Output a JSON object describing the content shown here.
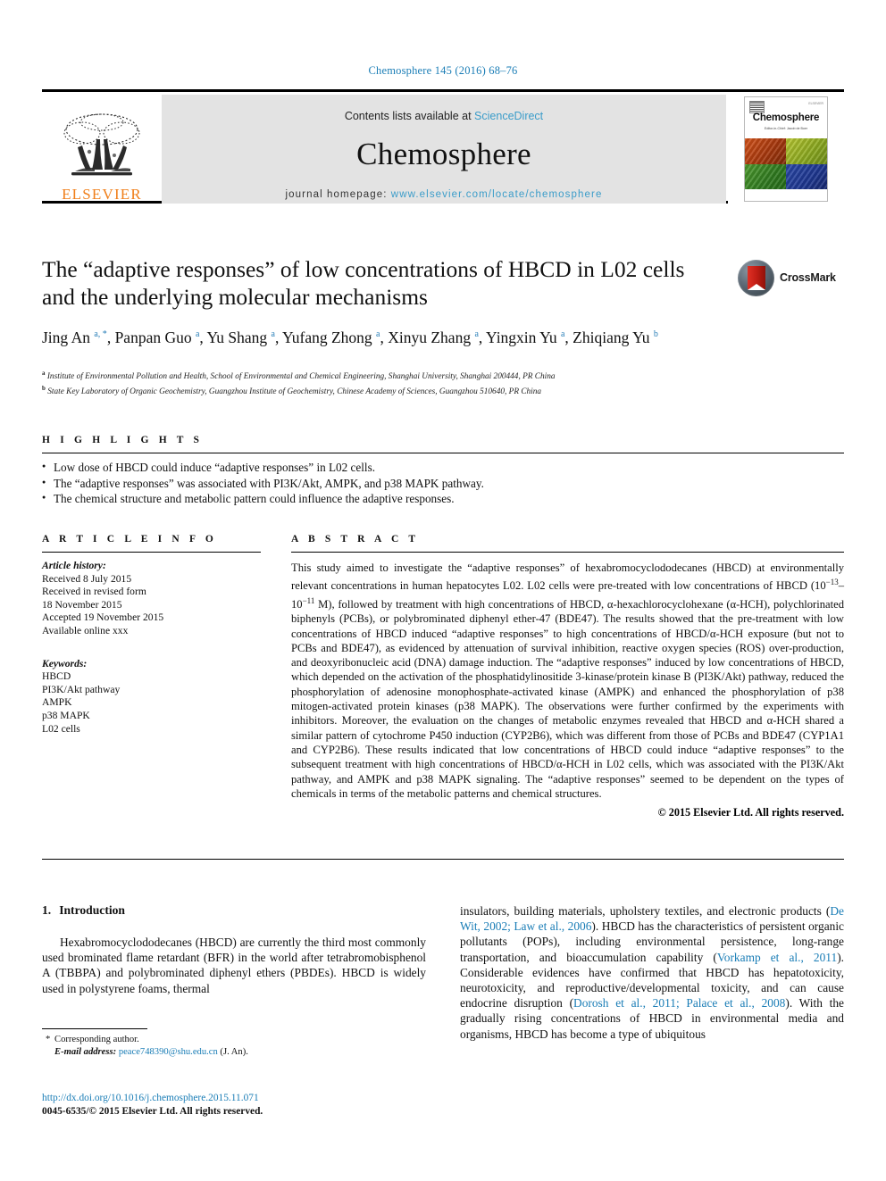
{
  "running_head": "Chemosphere 145 (2016) 68–76",
  "masthead": {
    "publisher_logo_label": "ELSEVIER",
    "contents_prefix": "Contents lists available at",
    "contents_link": "ScienceDirect",
    "journal_name": "Chemosphere",
    "homepage_prefix": "journal homepage:",
    "homepage_url": "www.elsevier.com/locate/chemosphere",
    "cover": {
      "title": "Chemosphere",
      "subtitle": "Editor-in-Chief: Jacob de Boer",
      "corner_label": "ELSEVIER"
    }
  },
  "article": {
    "title": "The “adaptive responses” of low concentrations of HBCD in L02 cells and the underlying molecular mechanisms",
    "crossmark_label": "CrossMark",
    "authors": [
      {
        "name": "Jing An",
        "sup": "a, *"
      },
      {
        "name": "Panpan Guo",
        "sup": "a"
      },
      {
        "name": "Yu Shang",
        "sup": "a"
      },
      {
        "name": "Yufang Zhong",
        "sup": "a"
      },
      {
        "name": "Xinyu Zhang",
        "sup": "a"
      },
      {
        "name": "Yingxin Yu",
        "sup": "a"
      },
      {
        "name": "Zhiqiang Yu",
        "sup": "b"
      }
    ],
    "affiliations": [
      {
        "marker": "a",
        "text": "Institute of Environmental Pollution and Health, School of Environmental and Chemical Engineering, Shanghai University, Shanghai 200444, PR China"
      },
      {
        "marker": "b",
        "text": "State Key Laboratory of Organic Geochemistry, Guangzhou Institute of Geochemistry, Chinese Academy of Sciences, Guangzhou 510640, PR China"
      }
    ]
  },
  "highlights": {
    "heading": "H I G H L I G H T S",
    "items": [
      "Low dose of HBCD could induce “adaptive responses” in L02 cells.",
      "The “adaptive responses” was associated with PI3K/Akt, AMPK, and p38 MAPK pathway.",
      "The chemical structure and metabolic pattern could influence the adaptive responses."
    ]
  },
  "article_info": {
    "heading": "A R T I C L E  I N F O",
    "history_label": "Article history:",
    "history": [
      "Received 8 July 2015",
      "Received in revised form",
      "18 November 2015",
      "Accepted 19 November 2015",
      "Available online xxx"
    ],
    "keywords_label": "Keywords:",
    "keywords": [
      "HBCD",
      "PI3K/Akt pathway",
      "AMPK",
      "p38 MAPK",
      "L02 cells"
    ]
  },
  "abstract": {
    "heading": "A B S T R A C T",
    "part1": "This study aimed to investigate the “adaptive responses” of hexabromocyclododecanes (HBCD) at environmentally relevant concentrations in human hepatocytes L02. L02 cells were pre-treated with low concentrations of HBCD (10",
    "exp1": "−13",
    "mid1": "–10",
    "exp2": "−11",
    "part2": " M), followed by treatment with high concentrations of HBCD, α-hexachlorocyclohexane (α-HCH), polychlorinated biphenyls (PCBs), or polybrominated diphenyl ether-47 (BDE47). The results showed that the pre-treatment with low concentrations of HBCD induced “adaptive responses” to high concentrations of HBCD/α-HCH exposure (but not to PCBs and BDE47), as evidenced by attenuation of survival inhibition, reactive oxygen species (ROS) over-production, and deoxyribonucleic acid (DNA) damage induction. The “adaptive responses” induced by low concentrations of HBCD, which depended on the activation of the phosphatidylinositide 3-kinase/protein kinase B (PI3K/Akt) pathway, reduced the phosphorylation of adenosine monophosphate-activated kinase (AMPK) and enhanced the phosphorylation of p38 mitogen-activated protein kinases (p38 MAPK). The observations were further confirmed by the experiments with inhibitors. Moreover, the evaluation on the changes of metabolic enzymes revealed that HBCD and α-HCH shared a similar pattern of cytochrome P450 induction (CYP2B6), which was different from those of PCBs and BDE47 (CYP1A1 and CYP2B6). These results indicated that low concentrations of HBCD could induce “adaptive responses” to the subsequent treatment with high concentrations of HBCD/α-HCH in L02 cells, which was associated with the PI3K/Akt pathway, and AMPK and p38 MAPK signaling. The “adaptive responses” seemed to be dependent on the types of chemicals in terms of the metabolic patterns and chemical structures.",
    "copyright": "© 2015 Elsevier Ltd. All rights reserved."
  },
  "body": {
    "section_number": "1.",
    "section_title": "Introduction",
    "left_paragraph": "Hexabromocyclododecanes (HBCD) are currently the third most commonly used brominated flame retardant (BFR) in the world after tetrabromobisphenol A (TBBPA) and polybrominated diphenyl ethers (PBDEs). HBCD is widely used in polystyrene foams, thermal",
    "right_p1a": "insulators, building materials, upholstery textiles, and electronic products (",
    "right_ref1": "De Wit, 2002; Law et al., 2006",
    "right_p1b": "). HBCD has the characteristics of persistent organic pollutants (POPs), including environmental persistence, long-range transportation, and bioaccumulation capability (",
    "right_ref2": "Vorkamp et al., 2011",
    "right_p1c": "). Considerable evidences have confirmed that HBCD has hepatotoxicity, neurotoxicity, and reproductive/developmental toxicity, and can cause endocrine disruption (",
    "right_ref3": "Dorosh et al., 2011; Palace et al., 2008",
    "right_p1d": "). With the gradually rising concentrations of HBCD in environmental media and organisms, HBCD has become a type of ubiquitous"
  },
  "footer": {
    "corresponding_star": "*",
    "corresponding_label": "Corresponding author.",
    "email_label": "E-mail address:",
    "email": "peace748390@shu.edu.cn",
    "email_suffix": "(J. An).",
    "doi": "http://dx.doi.org/10.1016/j.chemosphere.2015.11.071",
    "issn_line": "0045-6535/© 2015 Elsevier Ltd. All rights reserved."
  }
}
